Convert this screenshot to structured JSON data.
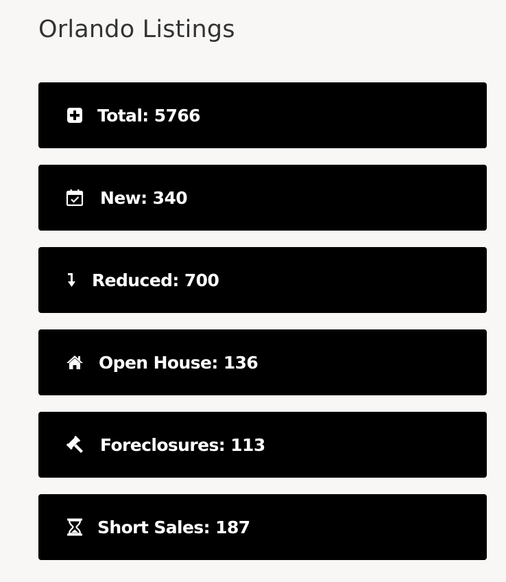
{
  "page": {
    "title": "Orlando Listings"
  },
  "theme": {
    "card_background": "#000000",
    "card_text": "#ffffff",
    "page_background": "#f8f7f5",
    "title_color": "#333333"
  },
  "listings": [
    {
      "label": "Total: 5766",
      "icon": "plus-square-icon"
    },
    {
      "label": "New: 340",
      "icon": "calendar-check-icon"
    },
    {
      "label": "Reduced: 700",
      "icon": "arrow-down-icon"
    },
    {
      "label": "Open House: 136",
      "icon": "home-icon"
    },
    {
      "label": "Foreclosures: 113",
      "icon": "gavel-icon"
    },
    {
      "label": "Short Sales: 187",
      "icon": "hourglass-icon"
    }
  ]
}
